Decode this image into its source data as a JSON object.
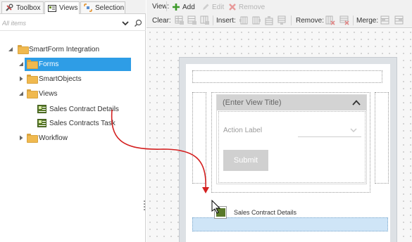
{
  "left_panel": {
    "tabs": [
      {
        "label": "Toolbox",
        "icon": "toolbox-icon"
      },
      {
        "label": "Views",
        "icon": "views-icon"
      },
      {
        "label": "Selection",
        "icon": "selection-icon"
      }
    ],
    "search": {
      "placeholder": "All items"
    },
    "tree": {
      "root": "SmartForm Integration",
      "forms": "Forms",
      "smartobjects": "SmartObjects",
      "views": "Views",
      "view_items": [
        "Sales Contract Details",
        "Sales Contracts Task"
      ],
      "workflow": "Workflow"
    }
  },
  "toolbar": {
    "view_label": "View:",
    "add_label": "Add",
    "edit_label": "Edit",
    "remove_label": "Remove",
    "clear_label": "Clear:",
    "insert_label": "Insert:",
    "remove2_label": "Remove:",
    "merge_label": "Merge:"
  },
  "canvas": {
    "view_title": "(Enter View Title)",
    "action_label": "Action Label",
    "submit_label": "Submit",
    "drag_item_label": "Sales Contract Details"
  },
  "colors": {
    "selection": "#2e9de6",
    "drop_target": "#cfe5f7",
    "arrow": "#d42020",
    "folder": "#f0b94f"
  }
}
